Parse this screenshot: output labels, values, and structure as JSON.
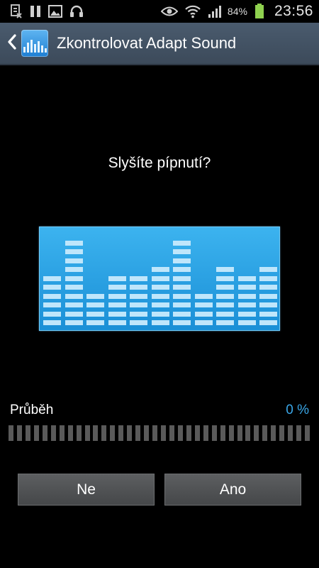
{
  "status_bar": {
    "battery_percent": "84%",
    "clock": "23:56",
    "icons_left": [
      "notification-doc-icon",
      "pause-icon",
      "image-icon",
      "headphones-icon"
    ],
    "icons_right": [
      "eye-icon",
      "wifi-icon",
      "signal-icon",
      "battery-icon"
    ]
  },
  "action_bar": {
    "title": "Zkontrolovat Adapt Sound",
    "back_icon": "chevron-left-icon",
    "app_icon": "equalizer-icon"
  },
  "question": "Slyšíte pípnutí?",
  "equalizer": {
    "column_levels": [
      6,
      10,
      4,
      6,
      6,
      7,
      10,
      4,
      7,
      6,
      7
    ],
    "colors": {
      "panel_top": "#3cb3ef",
      "panel_bottom": "#1a8fd6",
      "segment": "#bfe6fb"
    }
  },
  "progress": {
    "label": "Průběh",
    "value_text": "0 %",
    "fraction": 0,
    "accent": "#3aa7e8"
  },
  "buttons": {
    "no": "Ne",
    "yes": "Ano"
  }
}
